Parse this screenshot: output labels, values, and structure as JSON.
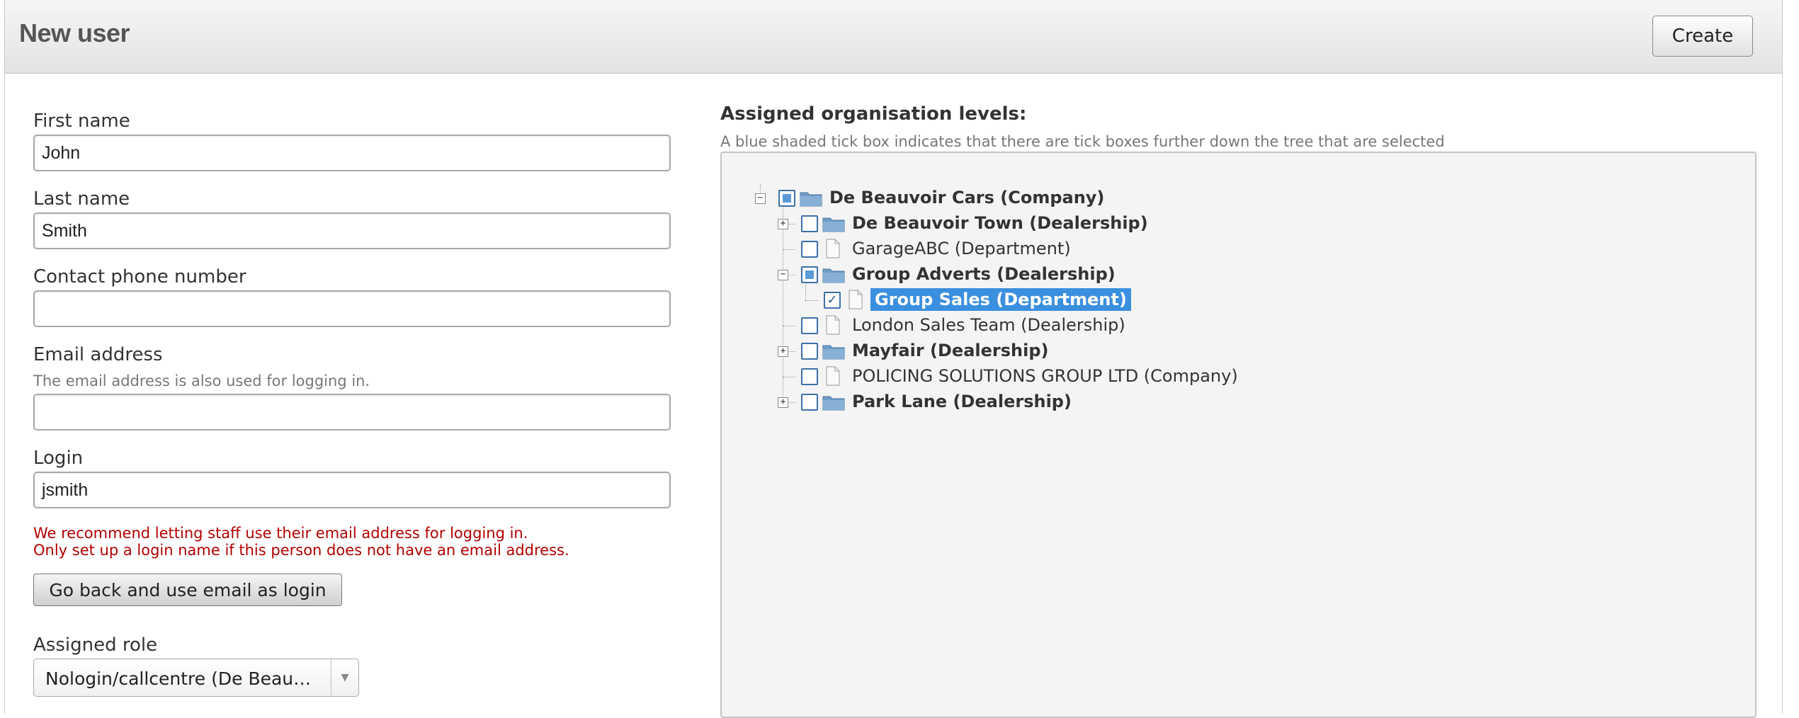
{
  "header": {
    "title": "New user",
    "create_label": "Create"
  },
  "form": {
    "first_name": {
      "label": "First name",
      "value": "John"
    },
    "last_name": {
      "label": "Last name",
      "value": "Smith"
    },
    "phone": {
      "label": "Contact phone number",
      "value": ""
    },
    "email": {
      "label": "Email address",
      "hint": "The email address is also used for logging in.",
      "value": ""
    },
    "login": {
      "label": "Login",
      "value": "jsmith"
    },
    "warning_line1": "We recommend letting staff use their email address for logging in.",
    "warning_line2": "Only set up a login name if this person does not have an email address.",
    "go_back_label": "Go back and use email as login",
    "role": {
      "label": "Assigned role",
      "value": "Nologin/callcentre (De Beau…"
    }
  },
  "org": {
    "title": "Assigned organisation levels:",
    "hint": "A blue shaded tick box indicates that there are tick boxes further down the tree that are selected",
    "items": [
      {
        "label": "De Beauvoir Cars (Company)",
        "type": "folder",
        "state": "partial",
        "toggle": "minus"
      },
      {
        "label": "De Beauvoir Town (Dealership)",
        "type": "folder",
        "state": "unchecked",
        "toggle": "plus"
      },
      {
        "label": "GarageABC (Department)",
        "type": "doc",
        "state": "unchecked",
        "toggle": "none"
      },
      {
        "label": "Group Adverts (Dealership)",
        "type": "folder",
        "state": "partial",
        "toggle": "minus"
      },
      {
        "label": "Group Sales (Department)",
        "type": "doc",
        "state": "checked",
        "selected": true,
        "toggle": "none"
      },
      {
        "label": "London Sales Team (Dealership)",
        "type": "doc",
        "state": "unchecked",
        "toggle": "none"
      },
      {
        "label": "Mayfair (Dealership)",
        "type": "folder",
        "state": "unchecked",
        "toggle": "plus"
      },
      {
        "label": "POLICING SOLUTIONS GROUP LTD (Company)",
        "type": "doc",
        "state": "unchecked",
        "toggle": "none"
      },
      {
        "label": "Park Lane (Dealership)",
        "type": "folder",
        "state": "unchecked",
        "toggle": "plus"
      }
    ]
  },
  "colors": {
    "accent": "#3a8fde",
    "warning": "#b30000",
    "checkbox_border": "#3e6fa8"
  },
  "icons": [
    "folder-icon",
    "document-icon",
    "expand-icon",
    "collapse-icon",
    "dropdown-arrow-icon"
  ]
}
